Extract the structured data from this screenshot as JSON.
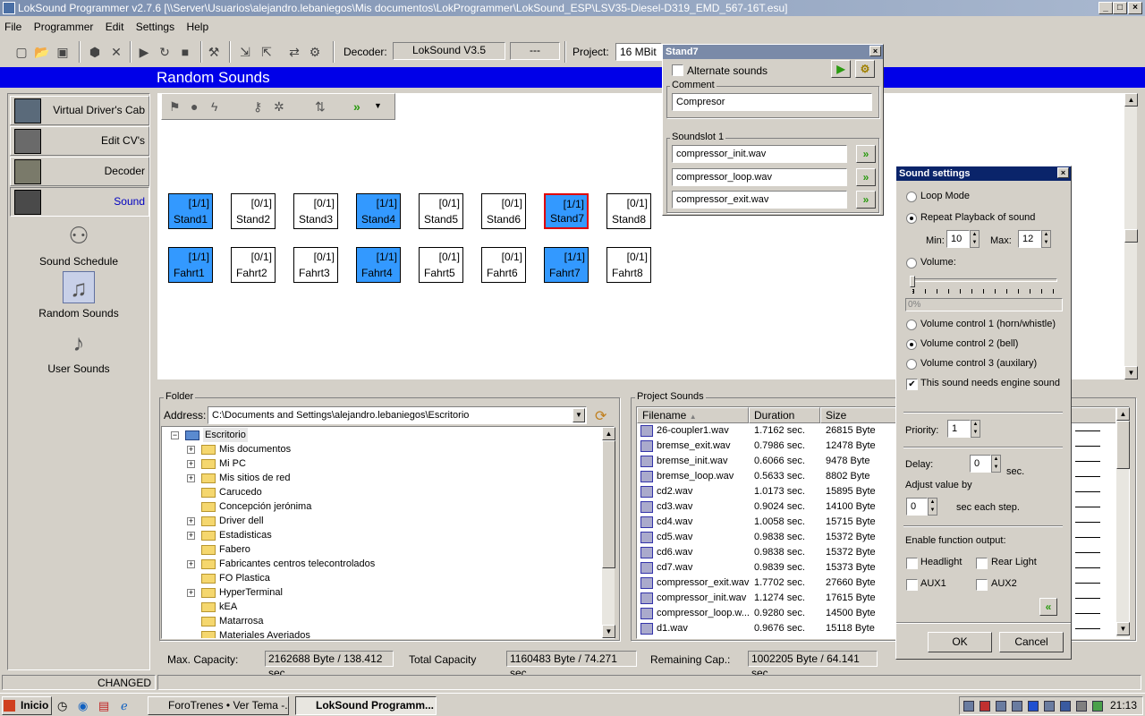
{
  "window": {
    "title": "LokSound Programmer  v2.7.6  [\\\\Server\\Usuarios\\alejandro.lebaniegos\\Mis documentos\\LokProgrammer\\LokSound_ESP\\LSV35-Diesel-D319_EMD_567-16T.esu]"
  },
  "menu": [
    "File",
    "Programmer",
    "Edit",
    "Settings",
    "Help"
  ],
  "toolbar": {
    "decoder_label": "Decoder:",
    "decoder_value": "LokSound V3.5",
    "decoder_btn": "---",
    "project_label": "Project:",
    "project_value": "16 MBit"
  },
  "page_title": "Random Sounds",
  "sidebar": {
    "nav": [
      "Virtual Driver's Cab",
      "Edit CV's",
      "Decoder",
      "Sound"
    ],
    "links": [
      "Sound Schedule",
      "Random Sounds",
      "User Sounds"
    ]
  },
  "slots": {
    "stand": [
      {
        "name": "Stand1",
        "count": "[1/1]",
        "active": true
      },
      {
        "name": "Stand2",
        "count": "[0/1]",
        "active": false
      },
      {
        "name": "Stand3",
        "count": "[0/1]",
        "active": false
      },
      {
        "name": "Stand4",
        "count": "[1/1]",
        "active": true
      },
      {
        "name": "Stand5",
        "count": "[0/1]",
        "active": false
      },
      {
        "name": "Stand6",
        "count": "[0/1]",
        "active": false
      },
      {
        "name": "Stand7",
        "count": "[1/1]",
        "active": true,
        "selected": true
      },
      {
        "name": "Stand8",
        "count": "[0/1]",
        "active": false
      }
    ],
    "fahrt": [
      {
        "name": "Fahrt1",
        "count": "[1/1]",
        "active": true
      },
      {
        "name": "Fahrt2",
        "count": "[0/1]",
        "active": false
      },
      {
        "name": "Fahrt3",
        "count": "[0/1]",
        "active": false
      },
      {
        "name": "Fahrt4",
        "count": "[1/1]",
        "active": true
      },
      {
        "name": "Fahrt5",
        "count": "[0/1]",
        "active": false
      },
      {
        "name": "Fahrt6",
        "count": "[0/1]",
        "active": false
      },
      {
        "name": "Fahrt7",
        "count": "[1/1]",
        "active": true
      },
      {
        "name": "Fahrt8",
        "count": "[0/1]",
        "active": false
      }
    ]
  },
  "folder": {
    "legend": "Folder",
    "address_label": "Address:",
    "address": "C:\\Documents and Settings\\alejandro.lebaniegos\\Escritorio",
    "tree": [
      {
        "label": "Escritorio",
        "level": 0,
        "expander": "−"
      },
      {
        "label": "Mis documentos",
        "level": 1,
        "expander": "+"
      },
      {
        "label": "Mi PC",
        "level": 1,
        "expander": "+"
      },
      {
        "label": "Mis sitios de red",
        "level": 1,
        "expander": "+"
      },
      {
        "label": "Carucedo",
        "level": 1,
        "expander": ""
      },
      {
        "label": "Concepción jerónima",
        "level": 1,
        "expander": ""
      },
      {
        "label": "Driver dell",
        "level": 1,
        "expander": "+"
      },
      {
        "label": "Estadisticas",
        "level": 1,
        "expander": "+"
      },
      {
        "label": "Fabero",
        "level": 1,
        "expander": ""
      },
      {
        "label": "Fabricantes centros telecontrolados",
        "level": 1,
        "expander": "+"
      },
      {
        "label": "FO Plastica",
        "level": 1,
        "expander": ""
      },
      {
        "label": "HyperTerminal",
        "level": 1,
        "expander": "+"
      },
      {
        "label": "kEA",
        "level": 1,
        "expander": ""
      },
      {
        "label": "Matarrosa",
        "level": 1,
        "expander": ""
      },
      {
        "label": "Materiales Averiados",
        "level": 1,
        "expander": ""
      }
    ]
  },
  "project_sounds": {
    "legend": "Project Sounds",
    "columns": [
      "Filename",
      "Duration",
      "Size"
    ],
    "rows": [
      {
        "file": "26-coupler1.wav",
        "dur": "1.7162 sec.",
        "size": "26815 Byte"
      },
      {
        "file": "bremse_exit.wav",
        "dur": "0.7986 sec.",
        "size": "12478 Byte"
      },
      {
        "file": "bremse_init.wav",
        "dur": "0.6066 sec.",
        "size": "9478 Byte"
      },
      {
        "file": "bremse_loop.wav",
        "dur": "0.5633 sec.",
        "size": "8802 Byte"
      },
      {
        "file": "cd2.wav",
        "dur": "1.0173 sec.",
        "size": "15895 Byte"
      },
      {
        "file": "cd3.wav",
        "dur": "0.9024 sec.",
        "size": "14100 Byte"
      },
      {
        "file": "cd4.wav",
        "dur": "1.0058 sec.",
        "size": "15715 Byte"
      },
      {
        "file": "cd5.wav",
        "dur": "0.9838 sec.",
        "size": "15372 Byte"
      },
      {
        "file": "cd6.wav",
        "dur": "0.9838 sec.",
        "size": "15372 Byte"
      },
      {
        "file": "cd7.wav",
        "dur": "0.9839 sec.",
        "size": "15373 Byte"
      },
      {
        "file": "compressor_exit.wav",
        "dur": "1.7702 sec.",
        "size": "27660 Byte"
      },
      {
        "file": "compressor_init.wav",
        "dur": "1.1274 sec.",
        "size": "17615 Byte"
      },
      {
        "file": "compressor_loop.w...",
        "dur": "0.9280 sec.",
        "size": "14500 Byte"
      },
      {
        "file": "d1.wav",
        "dur": "0.9676 sec.",
        "size": "15118 Byte"
      }
    ]
  },
  "capacity": {
    "max_label": "Max. Capacity:",
    "max": "2162688 Byte / 138.412 sec",
    "total_label": "Total Capacity",
    "total": "1160483 Byte / 74.271 sec",
    "remain_label": "Remaining Cap.:",
    "remain": "1002205 Byte / 64.141 sec"
  },
  "status": "CHANGED",
  "stand7_dialog": {
    "title": "Stand7",
    "alternate": "Alternate sounds",
    "comment_legend": "Comment",
    "comment": "Compresor",
    "slot_legend": "Soundslot 1",
    "files": [
      "compressor_init.wav",
      "compressor_loop.wav",
      "compressor_exit.wav"
    ]
  },
  "settings_dialog": {
    "title": "Sound settings",
    "loop": "Loop Mode",
    "repeat": "Repeat Playback of sound",
    "min_label": "Min:",
    "min": "10",
    "max_label": "Max:",
    "max": "12",
    "volume": "Volume:",
    "volume_pct": "0%",
    "vc1": "Volume control  1 (horn/whistle)",
    "vc2": "Volume control 2 (bell)",
    "vc3": "Volume control 3 (auxilary)",
    "engine": "This sound needs engine sound",
    "priority_label": "Priority:",
    "priority": "1",
    "delay_label": "Delay:",
    "delay": "0",
    "delay_unit": "sec.",
    "adjust_label": "Adjust value by",
    "adjust": "0",
    "adjust_unit": "sec each step.",
    "func_label": "Enable function output:",
    "headlight": "Headlight",
    "rearlight": "Rear Light",
    "aux1": "AUX1",
    "aux2": "AUX2",
    "ok": "OK",
    "cancel": "Cancel"
  },
  "taskbar": {
    "start": "Inicio",
    "tasks": [
      "ForoTrenes • Ver Tema -...",
      "LokSound Programm..."
    ],
    "clock": "21:13"
  }
}
